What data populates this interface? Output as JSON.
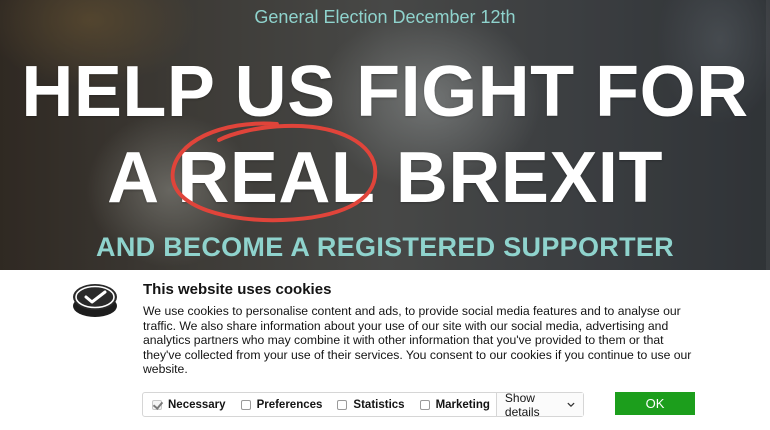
{
  "hero": {
    "eyebrow": "General Election December 12th",
    "headline_line1": "HELP US FIGHT FOR",
    "headline_line2_prefix": "A ",
    "headline_line2_circled": "REAL",
    "headline_line2_suffix": " BREXIT",
    "subheadline": "AND BECOME A REGISTERED SUPPORTER"
  },
  "cookie_banner": {
    "title": "This website uses cookies",
    "body": "We use cookies to personalise content and ads, to provide social media features and to analyse our traffic. We also share information about your use of our site with our social media, advertising and analytics partners who may combine it with other information that you've provided to them or that they've collected from your use of their services. You consent to our cookies if you continue to use our website.",
    "options": [
      {
        "label": "Necessary",
        "checked": true,
        "disabled": true
      },
      {
        "label": "Preferences",
        "checked": false
      },
      {
        "label": "Statistics",
        "checked": false
      },
      {
        "label": "Marketing",
        "checked": false
      }
    ],
    "show_details_label": "Show details",
    "ok_label": "OK"
  },
  "colors": {
    "accent_teal": "#8fd3cd",
    "circle_red": "#e0443a",
    "ok_green": "#1c9e1c"
  },
  "icons": {
    "logo": "checkmark-badge-icon",
    "dropdown": "chevron-down-icon"
  }
}
